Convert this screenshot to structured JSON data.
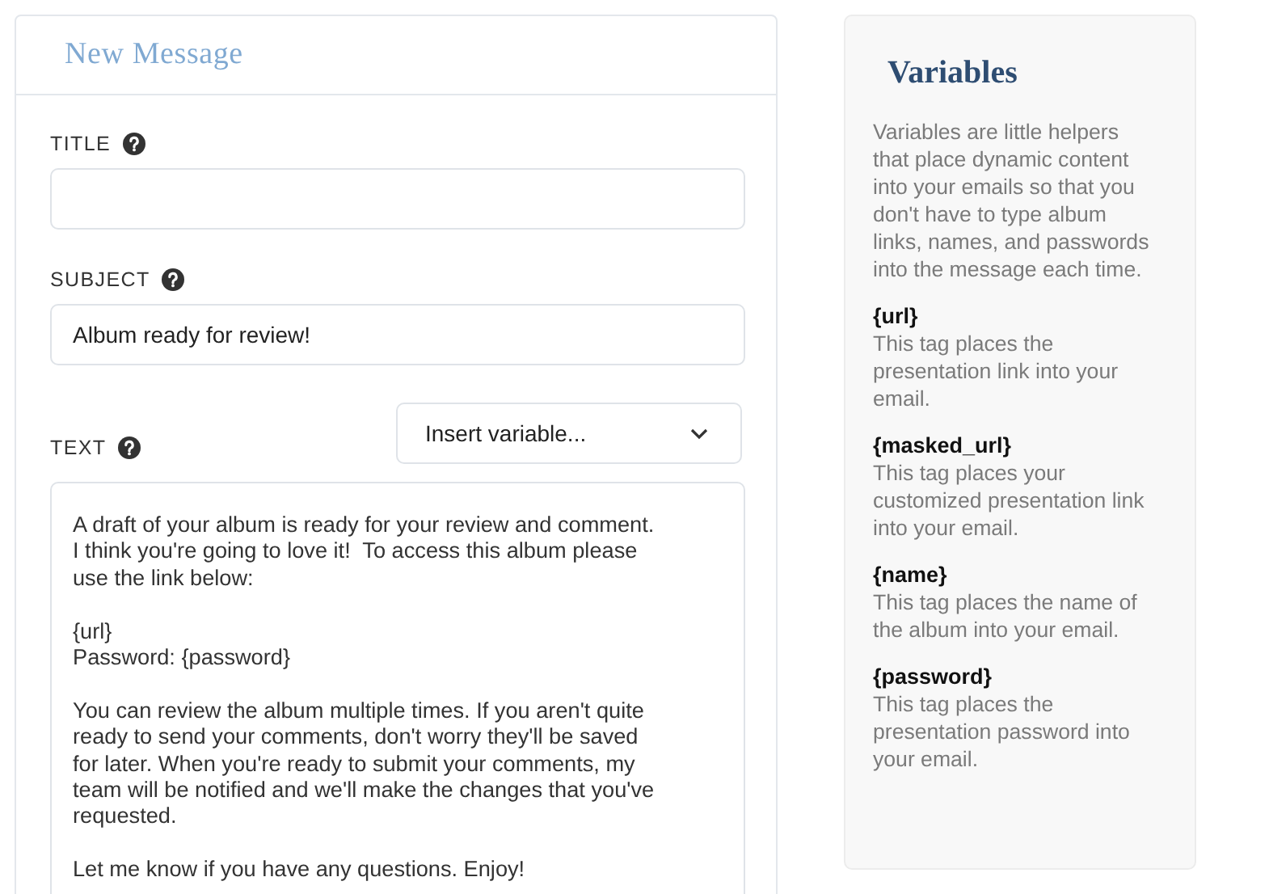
{
  "form": {
    "title": "New Message",
    "fields": [
      {
        "kind": "input",
        "label": "TITLE"
      },
      {
        "kind": "input",
        "label": "SUBJECT",
        "value": "Album ready for review!"
      },
      {
        "kind": "textarea",
        "label": "TEXT",
        "select": "Insert variable...",
        "value": "A draft of your album is ready for your review and comment.\nI think you're going to love it!  To access this album please\nuse the link below:\n\n{url}\nPassword: {password}\n\nYou can review the album multiple times. If you aren't quite\nready to send your comments, don't worry they'll be saved\nfor later. When you're ready to submit your comments, my\nteam will be notified and we'll make the changes that you've\nrequested.\n\nLet me know if you have any questions. Enjoy!"
      }
    ]
  },
  "sidebar": {
    "title": "Variables",
    "intro": "Variables are little helpers that place dynamic content into your emails so that you don't have to type album links, names, and passwords into the message each time.",
    "variables": [
      {
        "tag": "{url}",
        "description": "This tag places the presentation link into your email."
      },
      {
        "tag": "{masked_url}",
        "description": "This tag places your customized presentation link into your email."
      },
      {
        "tag": "{name}",
        "description": "This tag places the name of the album into your email."
      },
      {
        "tag": "{password}",
        "description": "This tag places the presentation password into your email."
      }
    ]
  }
}
